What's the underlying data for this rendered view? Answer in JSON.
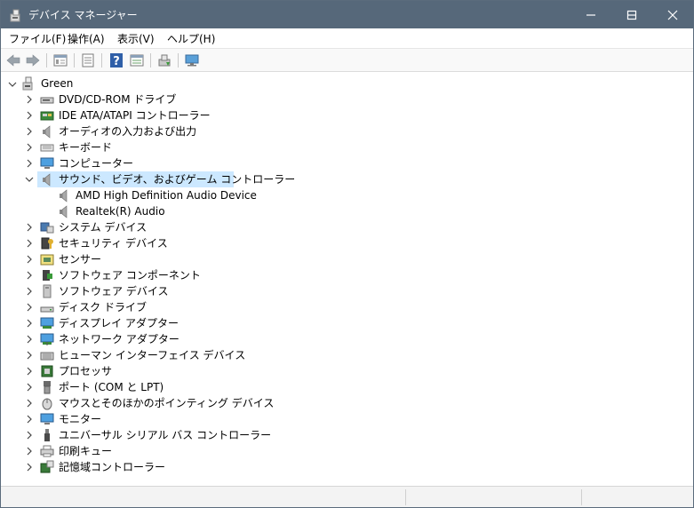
{
  "window": {
    "title": "デバイス マネージャー"
  },
  "menu": {
    "items": [
      "ファイル(F)",
      "操作(A)",
      "表示(V)",
      "ヘルプ(H)"
    ]
  },
  "toolbar": {
    "buttons": [
      "back-icon",
      "forward-icon",
      "properties-view-icon",
      "document-icon",
      "help-icon",
      "details-icon",
      "update-driver-icon",
      "scan-hardware-icon"
    ]
  },
  "tree": {
    "root": "Green",
    "categories": [
      {
        "label": "DVD/CD-ROM ドライブ",
        "icon": "dvd-drive-icon",
        "expanded": false
      },
      {
        "label": "IDE ATA/ATAPI コントローラー",
        "icon": "ide-controller-icon",
        "expanded": false
      },
      {
        "label": "オーディオの入力および出力",
        "icon": "speaker-icon",
        "expanded": false
      },
      {
        "label": "キーボード",
        "icon": "keyboard-icon",
        "expanded": false
      },
      {
        "label": "コンピューター",
        "icon": "computer-icon",
        "expanded": false
      },
      {
        "label": "サウンド、ビデオ、およびゲーム コントローラー",
        "icon": "speaker-icon",
        "expanded": true,
        "selected": true,
        "children": [
          "AMD High Definition Audio Device",
          "Realtek(R) Audio"
        ]
      },
      {
        "label": "システム デバイス",
        "icon": "system-device-icon",
        "expanded": false
      },
      {
        "label": "セキュリティ デバイス",
        "icon": "security-device-icon",
        "expanded": false
      },
      {
        "label": "センサー",
        "icon": "sensor-icon",
        "expanded": false
      },
      {
        "label": "ソフトウェア コンポーネント",
        "icon": "software-component-icon",
        "expanded": false
      },
      {
        "label": "ソフトウェア デバイス",
        "icon": "software-device-icon",
        "expanded": false
      },
      {
        "label": "ディスク ドライブ",
        "icon": "disk-drive-icon",
        "expanded": false
      },
      {
        "label": "ディスプレイ アダプター",
        "icon": "display-adapter-icon",
        "expanded": false
      },
      {
        "label": "ネットワーク アダプター",
        "icon": "network-adapter-icon",
        "expanded": false
      },
      {
        "label": "ヒューマン インターフェイス デバイス",
        "icon": "hid-icon",
        "expanded": false
      },
      {
        "label": "プロセッサ",
        "icon": "processor-icon",
        "expanded": false
      },
      {
        "label": "ポート (COM と LPT)",
        "icon": "port-icon",
        "expanded": false
      },
      {
        "label": "マウスとそのほかのポインティング デバイス",
        "icon": "mouse-icon",
        "expanded": false
      },
      {
        "label": "モニター",
        "icon": "monitor-icon",
        "expanded": false
      },
      {
        "label": "ユニバーサル シリアル バス コントローラー",
        "icon": "usb-icon",
        "expanded": false
      },
      {
        "label": "印刷キュー",
        "icon": "printer-icon",
        "expanded": false
      },
      {
        "label": "記憶域コントローラー",
        "icon": "storage-controller-icon",
        "expanded": false
      }
    ]
  },
  "colors": {
    "titlebar": "#56687a",
    "selection": "#cce8ff"
  }
}
